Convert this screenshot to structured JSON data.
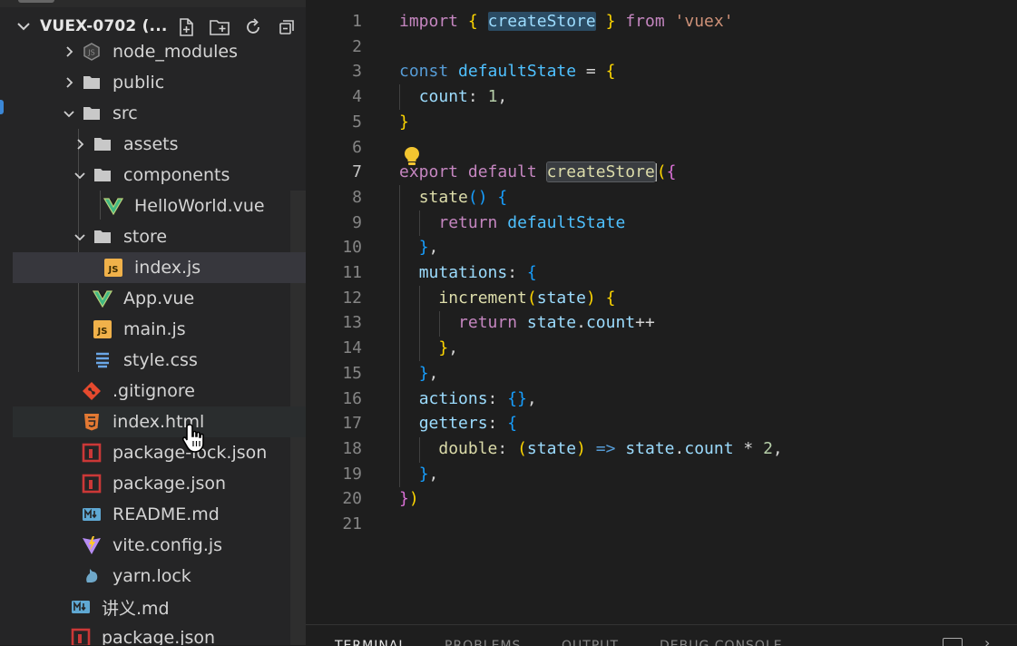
{
  "sidebar": {
    "project_title": "VUEX-0702 (...",
    "tree": [
      {
        "label": "node_modules",
        "icon": "nodejs-folder-icon",
        "twisty": "closed"
      },
      {
        "label": "public",
        "icon": "folder-icon",
        "twisty": "closed"
      },
      {
        "label": "src",
        "icon": "folder-icon",
        "twisty": "open"
      },
      {
        "label": "assets",
        "icon": "folder-icon",
        "twisty": "closed"
      },
      {
        "label": "components",
        "icon": "folder-icon",
        "twisty": "open"
      },
      {
        "label": "HelloWorld.vue",
        "icon": "vue-file-icon"
      },
      {
        "label": "store",
        "icon": "folder-icon",
        "twisty": "open"
      },
      {
        "label": "index.js",
        "icon": "js-file-icon"
      },
      {
        "label": "App.vue",
        "icon": "vue-file-icon"
      },
      {
        "label": "main.js",
        "icon": "js-file-icon"
      },
      {
        "label": "style.css",
        "icon": "css-file-icon"
      },
      {
        "label": ".gitignore",
        "icon": "git-file-icon"
      },
      {
        "label": "index.html",
        "icon": "html-file-icon"
      },
      {
        "label": "package-lock.json",
        "icon": "npm-file-icon"
      },
      {
        "label": "package.json",
        "icon": "npm-file-icon"
      },
      {
        "label": "README.md",
        "icon": "markdown-file-icon"
      },
      {
        "label": "vite.config.js",
        "icon": "vite-file-icon"
      },
      {
        "label": "yarn.lock",
        "icon": "yarn-file-icon"
      },
      {
        "label": "讲义.md",
        "icon": "markdown-file-icon"
      },
      {
        "label": "package.json",
        "icon": "npm-file-icon"
      }
    ]
  },
  "editor": {
    "active_line": 7,
    "line_numbers": [
      "1",
      "2",
      "3",
      "4",
      "5",
      "6",
      "7",
      "8",
      "9",
      "10",
      "11",
      "12",
      "13",
      "14",
      "15",
      "16",
      "17",
      "18",
      "19",
      "20",
      "21"
    ],
    "lines": [
      "import { createStore } from 'vuex'",
      "",
      "const defaultState = {",
      "  count: 1,",
      "}",
      "",
      "export default createStore({",
      "  state() {",
      "    return defaultState",
      "  },",
      "  mutations: {",
      "    increment(state) {",
      "      return state.count++",
      "    },",
      "  },",
      "  actions: {},",
      "  getters: {",
      "    double: (state) => state.count * 2,",
      "  },",
      "})",
      ""
    ]
  },
  "panel": {
    "tabs": [
      "TERMINAL",
      "PROBLEMS",
      "OUTPUT",
      "DEBUG CONSOLE"
    ],
    "active_tab": "TERMINAL"
  },
  "colors": {
    "sidebar_bg": "#252526",
    "editor_bg": "#1e1e1e",
    "selected_row": "#37373d",
    "keyword": "#569cd6",
    "control_keyword": "#c586c0",
    "function": "#dcdcaa",
    "variable": "#9cdcfe",
    "string": "#ce9178"
  }
}
